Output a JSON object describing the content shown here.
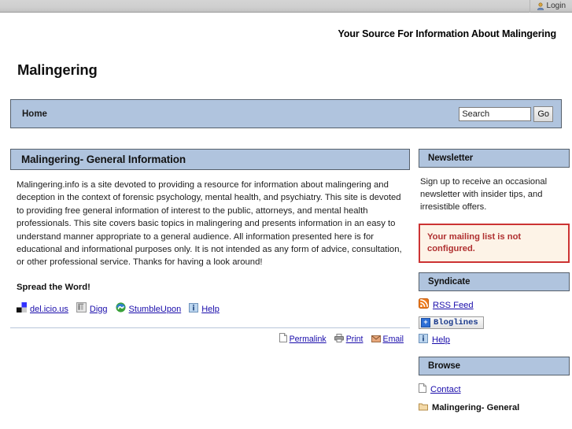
{
  "topbar": {
    "login_label": "Login",
    "login_icon": "user-icon"
  },
  "header": {
    "tagline": "Your Source For Information About Malingering",
    "site_title": "Malingering"
  },
  "nav": {
    "home_label": "Home",
    "search_value": "Search",
    "search_placeholder": "Search",
    "go_label": "Go"
  },
  "main": {
    "heading": "Malingering- General Information",
    "body": "Malingering.info is a site devoted to providing a resource for information about malingering and deception in the context of forensic psychology, mental health, and psychiatry. This site is devoted to providing free general information of interest to the public, attorneys, and mental health professionals. This site covers basic topics in malingering and presents information in an easy to understand manner appropriate to a general audience. All information presented here is for educational and informational purposes only. It is not intended as any form of advice, consultation, or other professional service. Thanks for having a look around!",
    "spread_title": "Spread the Word!",
    "share_links": [
      {
        "label": "del.icio.us",
        "icon": "delicious-icon"
      },
      {
        "label": "Digg",
        "icon": "digg-icon"
      },
      {
        "label": "StumbleUpon",
        "icon": "stumbleupon-icon"
      },
      {
        "label": "Help",
        "icon": "info-icon"
      }
    ],
    "meta_links": [
      {
        "label": "Permalink",
        "icon": "page-icon"
      },
      {
        "label": "Print",
        "icon": "printer-icon"
      },
      {
        "label": "Email",
        "icon": "envelope-icon"
      }
    ]
  },
  "sidebar": {
    "newsletter": {
      "heading": "Newsletter",
      "text": "Sign up to receive an occasional newsletter with insider tips, and irresistible offers.",
      "alert": "Your mailing list is not configured."
    },
    "syndicate": {
      "heading": "Syndicate",
      "rss_label": "RSS Feed",
      "bloglines_label": "Bloglines",
      "help_label": "Help"
    },
    "browse": {
      "heading": "Browse",
      "items": [
        {
          "label": "Contact",
          "icon": "page-icon",
          "style": "link"
        },
        {
          "label": "Malingering- General",
          "icon": "folder-icon",
          "style": "current"
        }
      ]
    }
  },
  "colors": {
    "header_blue": "#b0c4de",
    "link_blue": "#1a0dab",
    "alert_red": "#cc3333",
    "alert_bg": "#fdf3e7",
    "rss_orange": "#ee7a1a"
  }
}
